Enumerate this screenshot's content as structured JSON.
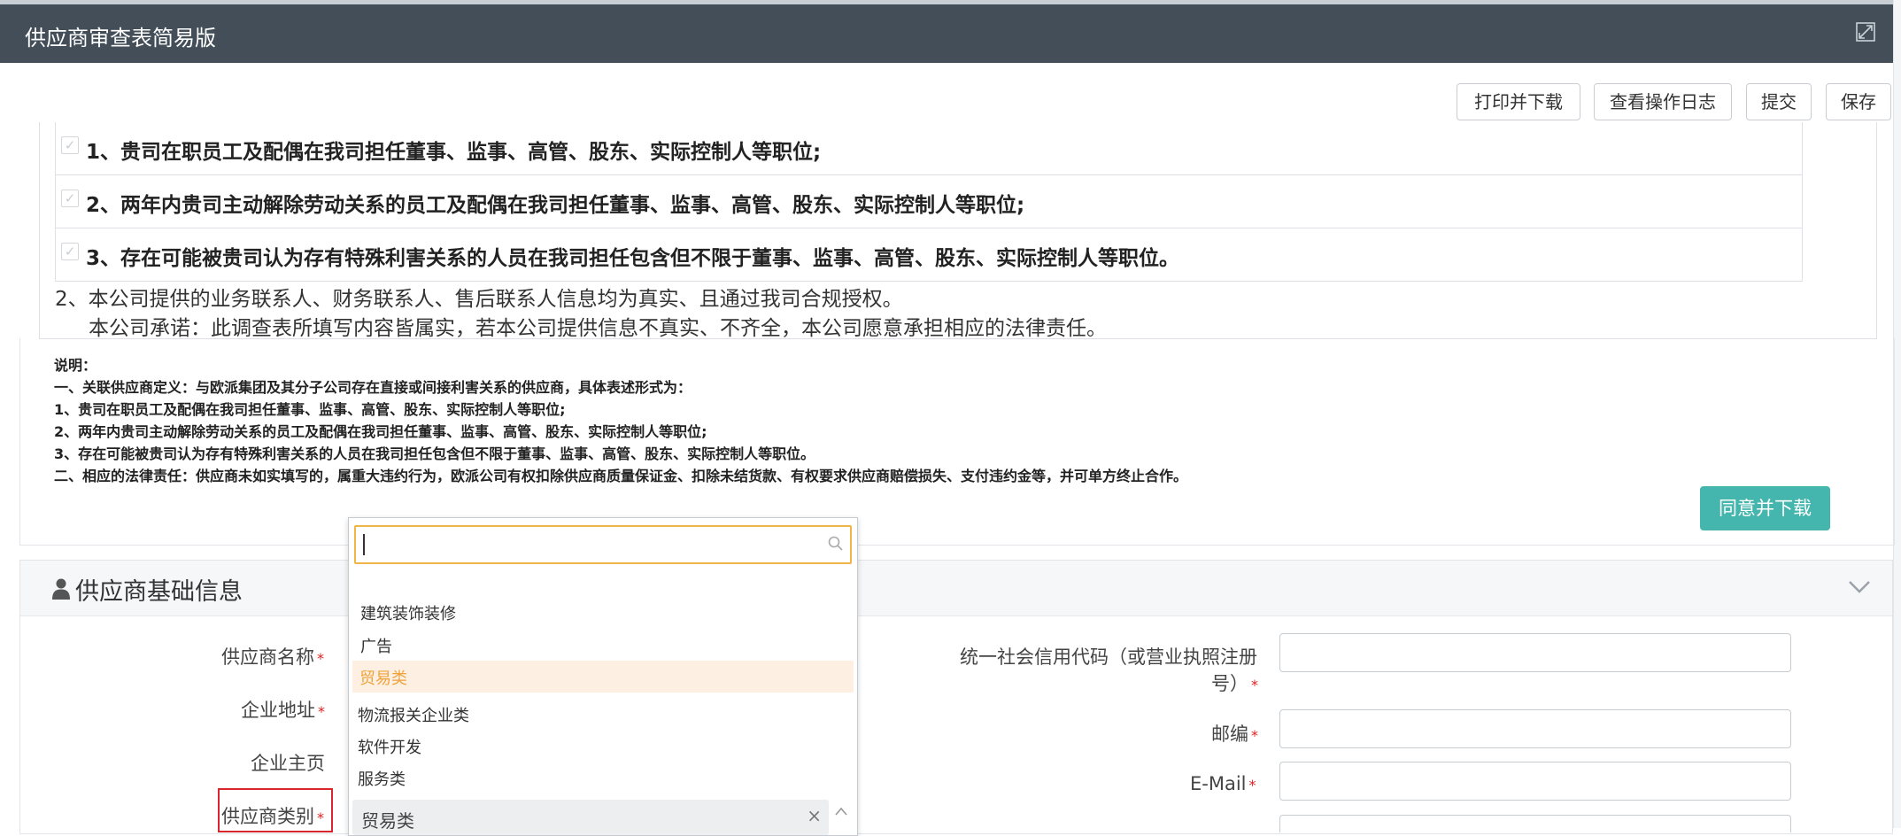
{
  "window": {
    "title": "供应商审查表简易版",
    "maximize_icon": "maximize-icon"
  },
  "toolbar": {
    "print_label": "打印并下载",
    "log_label": "查看操作日志",
    "submit_label": "提交",
    "save_label": "保存"
  },
  "commitments": [
    "1、贵司在职员工及配偶在我司担任董事、监事、高管、股东、实际控制人等职位;",
    "2、两年内贵司主动解除劳动关系的员工及配偶在我司担任董事、监事、高管、股东、实际控制人等职位;",
    "3、存在可能被贵司认为存有特殊利害关系的人员在我司担任包含但不限于董事、监事、高管、股东、实际控制人等职位。"
  ],
  "statements": {
    "line1": "2、本公司提供的业务联系人、财务联系人、售后联系人信息均为真实、且通过我司合规授权。",
    "line2": "本公司承诺：此调查表所填写内容皆属实，若本公司提供信息不真实、不齐全，本公司愿意承担相应的法律责任。"
  },
  "notes": [
    "说明：",
    "一、关联供应商定义：与欧派集团及其分子公司存在直接或间接利害关系的供应商，具体表述形式为：",
    "1、贵司在职员工及配偶在我司担任董事、监事、高管、股东、实际控制人等职位;",
    "2、两年内贵司主动解除劳动关系的员工及配偶在我司担任董事、监事、高管、股东、实际控制人等职位;",
    "3、存在可能被贵司认为存有特殊利害关系的人员在我司担任包含但不限于董事、监事、高管、股东、实际控制人等职位。",
    "二、相应的法律责任：供应商未如实填写的，属重大违约行为，欧派公司有权扣除供应商质量保证金、扣除未结货款、有权要求供应商赔偿损失、支付违约金等，并可单方终止合作。"
  ],
  "agree_label": "同意并下载",
  "section": {
    "title": "供应商基础信息",
    "icon": "user-icon",
    "collapse_icon": "chevron-up-icon"
  },
  "form": {
    "name_label": "供应商名称",
    "address_label": "企业地址",
    "homepage_label": "企业主页",
    "category_label": "供应商类别",
    "credit_label_1": "统一社会信用代码（或营业执照注册",
    "credit_label_2": "号）",
    "zip_label": "邮编",
    "email_label": "E-Mail",
    "required_mark": "*"
  },
  "dropdown": {
    "search_value": "",
    "options": [
      "建筑装饰装修",
      "广告",
      "贸易类",
      "物流报关企业类",
      "软件开发",
      "服务类"
    ],
    "selected": "贸易类",
    "tag": "贸易类",
    "tag_close": "×"
  }
}
